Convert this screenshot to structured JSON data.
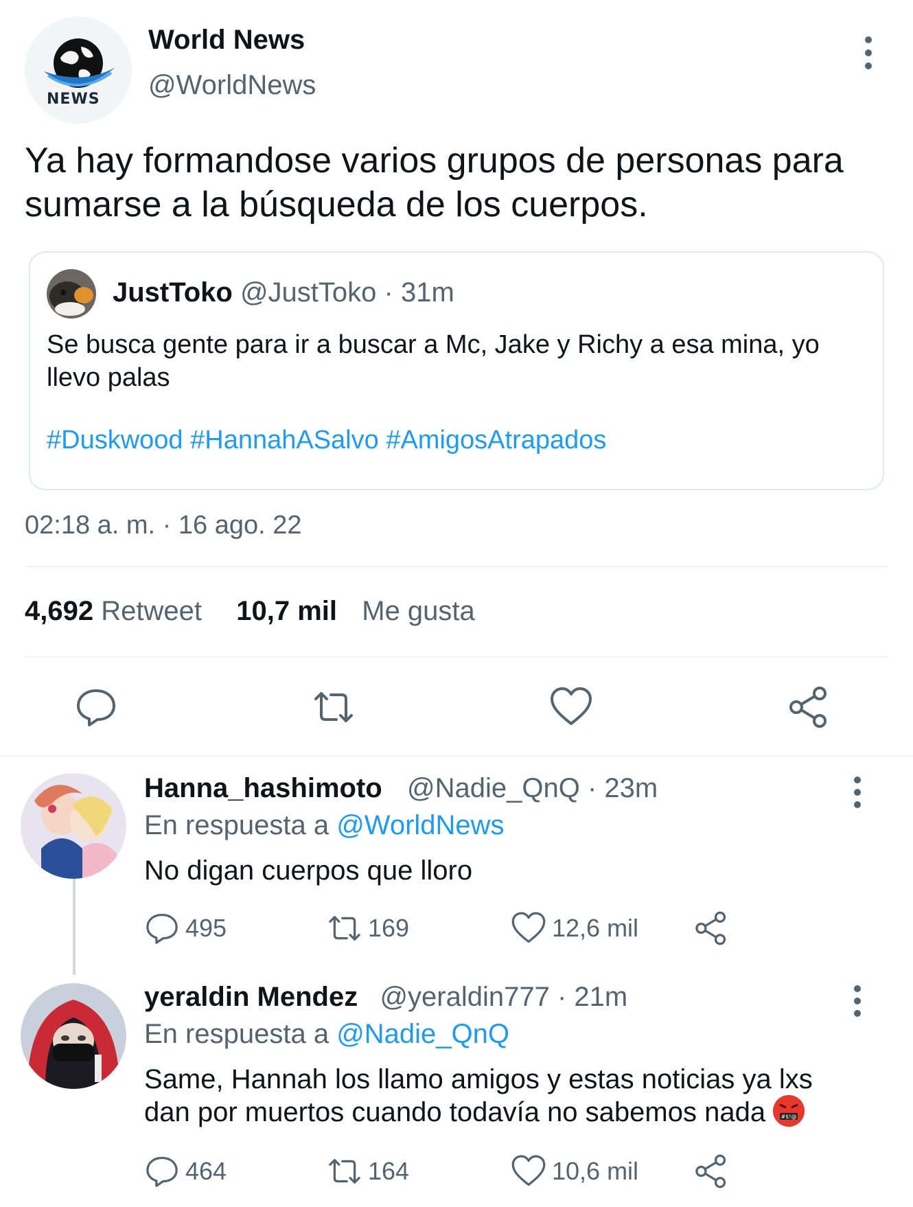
{
  "tweet": {
    "author_name": "World News",
    "author_handle": "@WorldNews",
    "avatar_caption": "NEWS",
    "text": "Ya hay formandose varios grupos de personas para sumarse a la búsqueda de los cuerpos.",
    "timestamp": "02:18 a. m. · 16 ago. 22",
    "retweets_count": "4,692",
    "retweets_label": "Retweet",
    "likes_count": "10,7 mil",
    "likes_label": "Me gusta"
  },
  "quote": {
    "author_name": "JustToko",
    "author_handle": "@JustToko",
    "time": "· 31m",
    "text": "Se busca gente para ir a buscar a Mc, Jake y Richy a esa mina, yo llevo palas",
    "hashtags": "#Duskwood #HannahASalvo #AmigosAtrapados"
  },
  "actions": {
    "icons": [
      "reply-icon",
      "retweet-icon",
      "like-icon",
      "share-icon"
    ]
  },
  "replies": [
    {
      "author_name": "Hanna_hashimoto",
      "author_handle": "@Nadie_QnQ",
      "time": "· 23m",
      "reply_prefix": "En respuesta a",
      "reply_to": "@WorldNews",
      "text": "No digan cuerpos que lloro",
      "replies": "495",
      "retweets": "169",
      "likes": "12,6 mil"
    },
    {
      "author_name": "yeraldin Mendez",
      "author_handle": "@yeraldin777",
      "time": "· 21m",
      "reply_prefix": "En respuesta a",
      "reply_to": "@Nadie_QnQ",
      "text": "Same, Hannah los llamo amigos y estas noticias ya lxs dan por muertos cuando todavía no sabemos nada",
      "replies": "464",
      "retweets": "164",
      "likes": "10,6 mil"
    }
  ],
  "colors": {
    "link": "#1d9bf0",
    "secondary_text": "#536471",
    "border": "#e1e8ed"
  }
}
